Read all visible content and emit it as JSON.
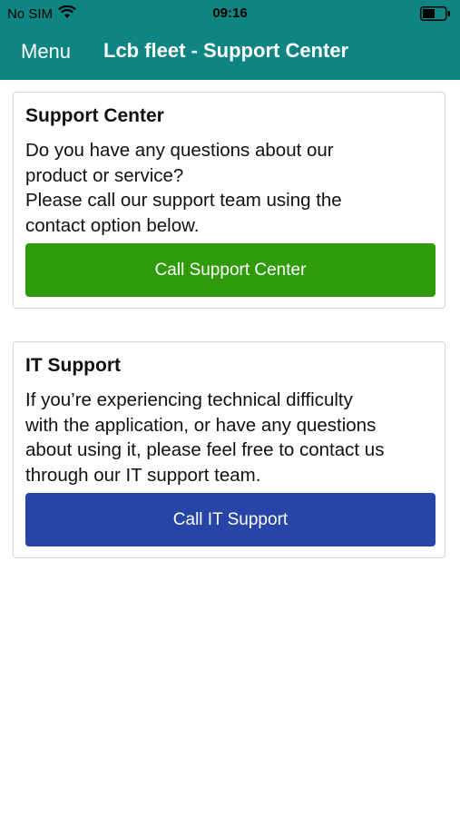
{
  "status_bar": {
    "carrier": "No SIM",
    "time": "09:16",
    "wifi_icon": "wifi-icon",
    "battery_icon": "battery-icon"
  },
  "nav": {
    "menu_label": "Menu",
    "title": "Lcb fleet - Support Center"
  },
  "support_center": {
    "title": "Support Center",
    "lines": [
      "Do you have any questions about our",
      "product or service?",
      "Please call our support team using the",
      "contact option below."
    ],
    "button_label": "Call Support Center",
    "button_color": "#2f9a0a"
  },
  "it_support": {
    "title": "IT Support",
    "lines": [
      "If you’re experiencing technical difficulty",
      "with the application, or have any questions",
      "about using it, please feel free to contact us",
      "through our IT support team."
    ],
    "button_label": "Call IT Support",
    "button_color": "#2645a7"
  },
  "colors": {
    "header": "#0e8582"
  }
}
